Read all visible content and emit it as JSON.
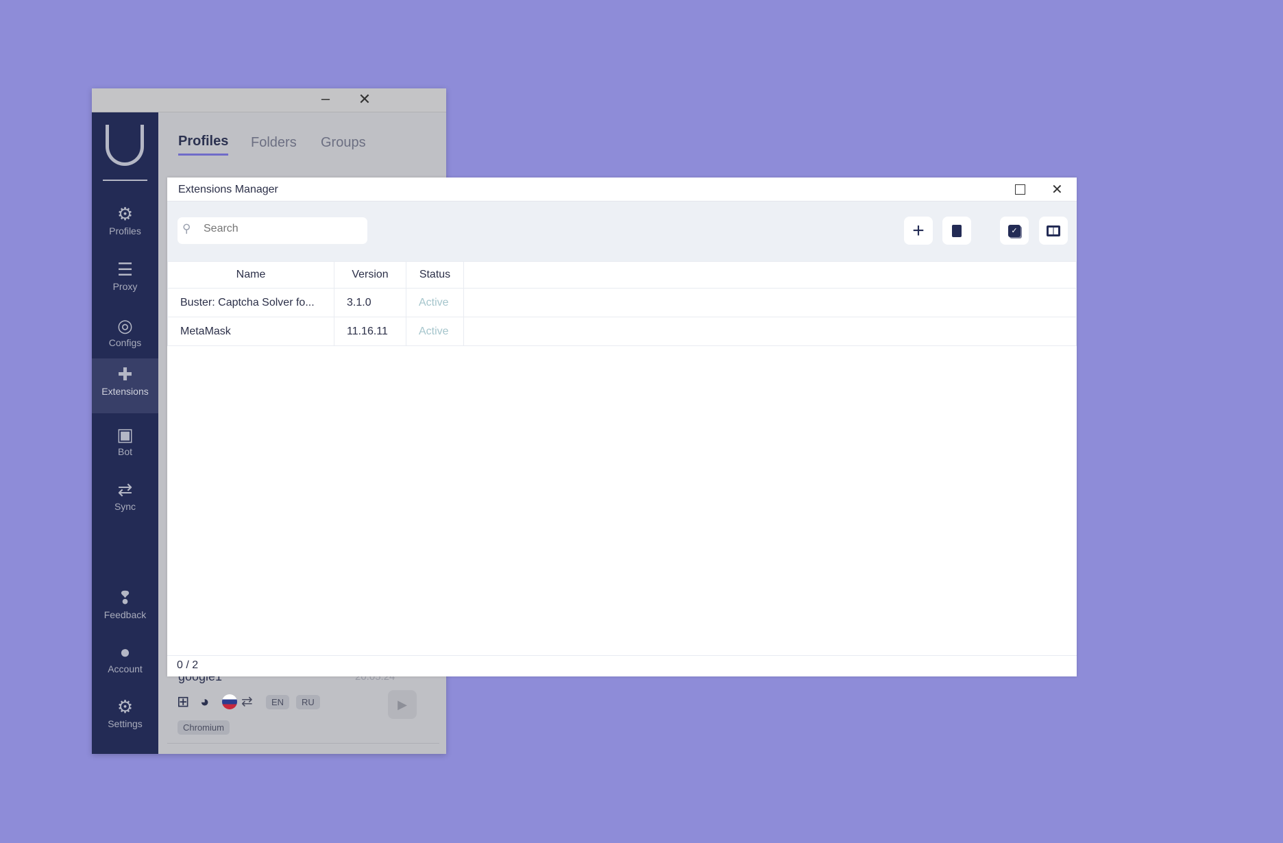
{
  "back_window": {
    "tabs": [
      {
        "label": "Profiles",
        "active": true
      },
      {
        "label": "Folders"
      },
      {
        "label": "Groups"
      }
    ],
    "sidebar": {
      "items": [
        {
          "label": "Profiles",
          "icon": "users-gear-icon"
        },
        {
          "label": "Proxy",
          "icon": "server-icon"
        },
        {
          "label": "Configs",
          "icon": "fingerprint-icon"
        },
        {
          "label": "Extensions",
          "icon": "puzzle-icon",
          "selected": true
        },
        {
          "label": "Bot",
          "icon": "robot-icon"
        },
        {
          "label": "Sync",
          "icon": "sync-icon"
        },
        {
          "label": "Feedback",
          "icon": "feedback-icon"
        },
        {
          "label": "Account",
          "icon": "account-icon"
        },
        {
          "label": "Settings",
          "icon": "gear-icon"
        }
      ]
    },
    "profile": {
      "name": "google1",
      "date": "20.05.24",
      "langs": [
        "EN",
        "RU"
      ],
      "browser": "Chromium"
    }
  },
  "modal": {
    "title": "Extensions Manager",
    "search_placeholder": "Search",
    "columns": [
      "Name",
      "Version",
      "Status"
    ],
    "rows": [
      {
        "name": "Buster: Captcha Solver fo...",
        "version": "3.1.0",
        "status": "Active"
      },
      {
        "name": "MetaMask",
        "version": "11.16.11",
        "status": "Active"
      }
    ],
    "footer": "0 / 2"
  },
  "colors": {
    "background": "#8e8cd8",
    "sidebar": "#232b55",
    "accent": "#6f6bc9",
    "status_active": "#a5c5cc"
  }
}
